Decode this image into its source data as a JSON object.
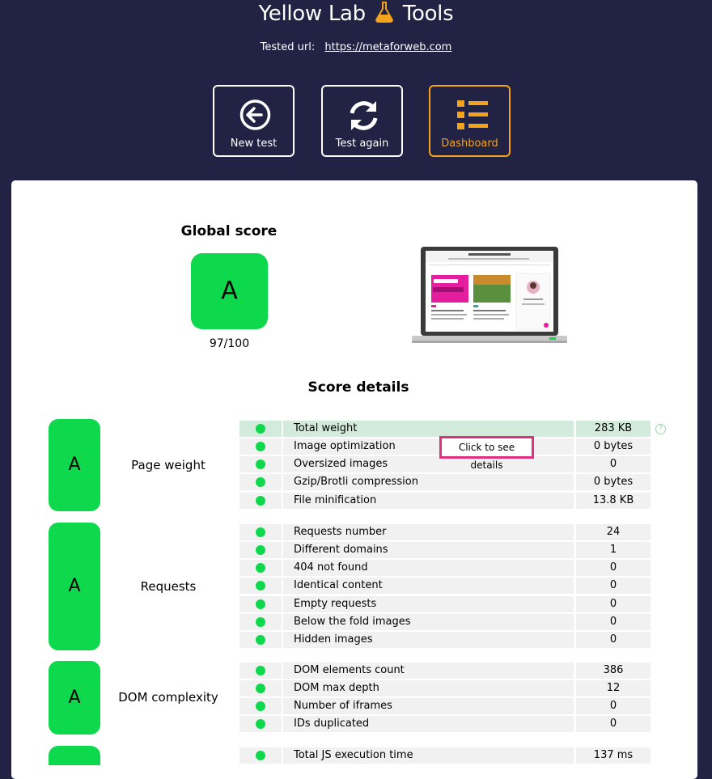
{
  "header": {
    "title_left": "Yellow Lab",
    "title_right": "Tools",
    "tested_label": "Tested url:",
    "tested_url": "https://metaforweb.com"
  },
  "buttons": {
    "new_test": "New test",
    "test_again": "Test again",
    "dashboard": "Dashboard"
  },
  "global": {
    "title": "Global score",
    "grade": "A",
    "score": "97/100"
  },
  "details_title": "Score details",
  "tooltip": "Click to see details",
  "categories": [
    {
      "label": "Page weight",
      "grade": "A",
      "rows": [
        {
          "name": "Total weight",
          "value": "283 KB"
        },
        {
          "name": "Image optimization",
          "value": "0 bytes"
        },
        {
          "name": "Oversized images",
          "value": "0"
        },
        {
          "name": "Gzip/Brotli compression",
          "value": "0 bytes"
        },
        {
          "name": "File minification",
          "value": "13.8 KB"
        }
      ]
    },
    {
      "label": "Requests",
      "grade": "A",
      "rows": [
        {
          "name": "Requests number",
          "value": "24"
        },
        {
          "name": "Different domains",
          "value": "1"
        },
        {
          "name": "404 not found",
          "value": "0"
        },
        {
          "name": "Identical content",
          "value": "0"
        },
        {
          "name": "Empty requests",
          "value": "0"
        },
        {
          "name": "Below the fold images",
          "value": "0"
        },
        {
          "name": "Hidden images",
          "value": "0"
        }
      ]
    },
    {
      "label": "DOM complexity",
      "grade": "A",
      "rows": [
        {
          "name": "DOM elements count",
          "value": "386"
        },
        {
          "name": "DOM max depth",
          "value": "12"
        },
        {
          "name": "Number of iframes",
          "value": "0"
        },
        {
          "name": "IDs duplicated",
          "value": "0"
        }
      ]
    },
    {
      "label": "",
      "grade": "",
      "rows": [
        {
          "name": "Total JS execution time",
          "value": "137 ms"
        }
      ]
    }
  ],
  "colors": {
    "accent": "#f6a31c",
    "grade": "#0ed84c",
    "bg": "#212244",
    "highlight": "#e0307f"
  },
  "icons": {
    "new_test": "arrow-left-circle-icon",
    "test_again": "refresh-icon",
    "dashboard": "list-icon",
    "title": "flask-icon"
  }
}
